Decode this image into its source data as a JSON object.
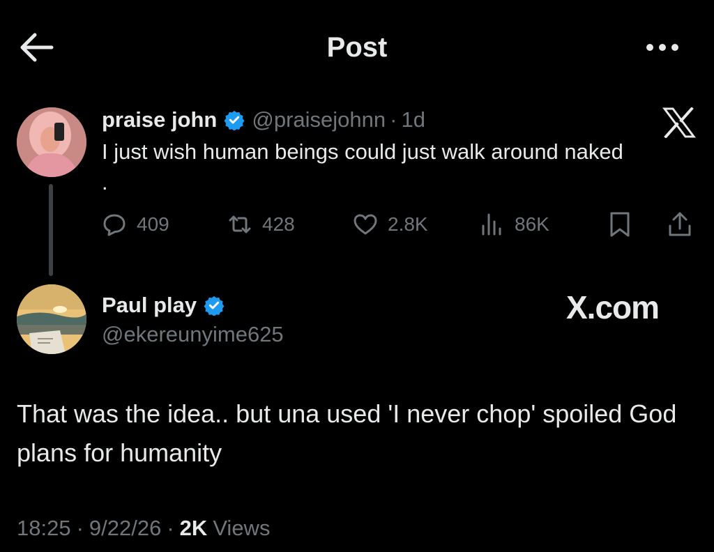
{
  "header": {
    "title": "Post",
    "back_icon": "back-arrow-icon",
    "more_icon": "more-dots-icon"
  },
  "quoted_post": {
    "author_name": "praise john",
    "verified": true,
    "handle": "@praisejohnn",
    "separator": "·",
    "time": "1d",
    "text": "I just wish human beings could just walk around naked\n.",
    "platform_icon": "x-logo-icon",
    "stats": {
      "replies": "409",
      "reposts": "428",
      "likes": "2.8K",
      "views": "86K"
    }
  },
  "reply_post": {
    "author_name": "Paul play",
    "verified": true,
    "handle": "@ekereunyime625",
    "watermark": "X.com",
    "text": "That was the idea.. but una used 'I never chop' spoiled God plans for humanity"
  },
  "meta": {
    "time": "18:25",
    "sep1": "·",
    "date": "9/22/26",
    "sep2": "·",
    "views_count": "2K",
    "views_label": "Views"
  },
  "colors": {
    "background": "#000000",
    "text_primary": "#e7e9ea",
    "text_secondary": "#71767b",
    "verified": "#1d9bf0"
  }
}
